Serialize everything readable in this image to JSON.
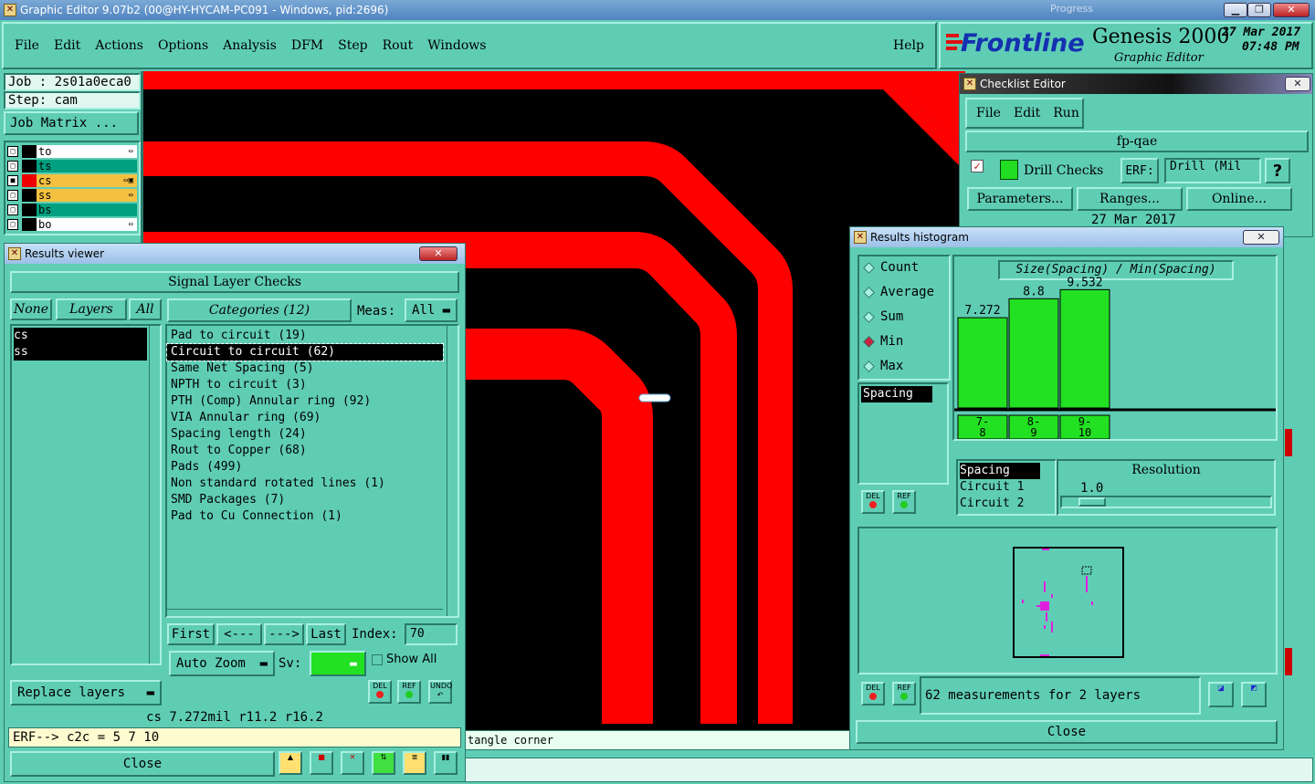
{
  "window": {
    "title": "Graphic Editor 9.07b2 (00@HY-HYCAM-PC091 - Windows, pid:2696)",
    "ghost_title": "Progress"
  },
  "menu": [
    "File",
    "Edit",
    "Actions",
    "Options",
    "Analysis",
    "DFM",
    "Step",
    "Rout",
    "Windows"
  ],
  "help_label": "Help",
  "brand": {
    "logo": "Frontline",
    "product": "Genesis 2000",
    "subtitle": "Graphic Editor",
    "date": "27 Mar 2017",
    "time": "07:48 PM"
  },
  "job": {
    "job": "Job : 2s01a0eca0",
    "step": "Step: cam",
    "matrix": "Job Matrix ..."
  },
  "layers": [
    {
      "name": "to",
      "color": "#ffffff",
      "mark": "⇔"
    },
    {
      "name": "ts",
      "color": "#00a080",
      "mark": ""
    },
    {
      "name": "cs",
      "color": "#f4c040",
      "mark": "⇔▣"
    },
    {
      "name": "ss",
      "color": "#f4c040",
      "mark": "⇔"
    },
    {
      "name": "bs",
      "color": "#00a080",
      "mark": ""
    },
    {
      "name": "bo",
      "color": "#ffffff",
      "mark": "⇔"
    }
  ],
  "status_bar": {
    "text": "tangle corner"
  },
  "results_viewer": {
    "title": "Results viewer",
    "header": "Signal Layer Checks",
    "none": "None",
    "layers": "Layers",
    "all": "All",
    "categories": "Categories (12)",
    "meas_label": "Meas:",
    "meas_value": "All",
    "layer_list": [
      "cs",
      "ss"
    ],
    "category_list": [
      "Pad to circuit (19)",
      "Circuit to circuit (62)",
      "Same Net Spacing (5)",
      "NPTH to circuit (3)",
      "PTH (Comp) Annular ring (92)",
      "VIA Annular ring (69)",
      "Spacing length (24)",
      "Rout to Copper (68)",
      "Pads (499)",
      "Non standard rotated lines (1)",
      "SMD Packages (7)",
      "Pad to Cu Connection (1)"
    ],
    "selected_index": 1,
    "nav": {
      "first": "First",
      "prev": "<---",
      "next": "--->",
      "last": "Last",
      "index_label": "Index:",
      "index_value": "70"
    },
    "auto_zoom": "Auto Zoom",
    "sv_label": "Sv:",
    "show_all": "Show All",
    "replace_layers": "Replace layers",
    "icons": {
      "del": "DEL",
      "ref": "REF",
      "undo": "UNDO"
    },
    "measure_text": "cs 7.272mil  r11.2  r16.2",
    "erf_text": "ERF--> c2c = 5 7 10",
    "close": "Close"
  },
  "checklist": {
    "title": "Checklist Editor",
    "menu": [
      "File",
      "Edit",
      "Run"
    ],
    "name": "fp-qae",
    "check_name": "Drill Checks",
    "erf_label": "ERF:",
    "erf_value": "Drill (Mil",
    "help": "?",
    "buttons": [
      "Parameters...",
      "Ranges...",
      "Online..."
    ],
    "date": "27 Mar 2017"
  },
  "histogram": {
    "title": "Results histogram",
    "modes": [
      "Count",
      "Average",
      "Sum",
      "Min",
      "Max"
    ],
    "selected_mode": "Min",
    "chart_title": "Size(Spacing) / Min(Spacing)",
    "bars": [
      {
        "label": "7.272",
        "value": 7.272,
        "range": [
          "7-",
          "8"
        ]
      },
      {
        "label": "8.8",
        "value": 8.8,
        "range": [
          "8-",
          "9"
        ]
      },
      {
        "label": "9.532",
        "value": 9.532,
        "range": [
          "9-",
          "10"
        ]
      }
    ],
    "left_list": [
      "Spacing"
    ],
    "attr_list": [
      "Spacing",
      "Circuit 1",
      "Circuit 2"
    ],
    "resolution_label": "Resolution",
    "resolution_value": "1.0",
    "summary": "62 measurements for 2 layers",
    "icons": {
      "del": "DEL",
      "ref": "REF"
    },
    "close": "Close"
  },
  "chart_data": {
    "type": "bar",
    "title": "Size(Spacing) / Min(Spacing)",
    "categories": [
      "7-8",
      "8-9",
      "9-10"
    ],
    "values": [
      7.272,
      8.8,
      9.532
    ]
  },
  "colors": {
    "ui": "#5fcdb4",
    "trace": "#ff0000",
    "canvas": "#000000",
    "bar": "#22e022"
  }
}
